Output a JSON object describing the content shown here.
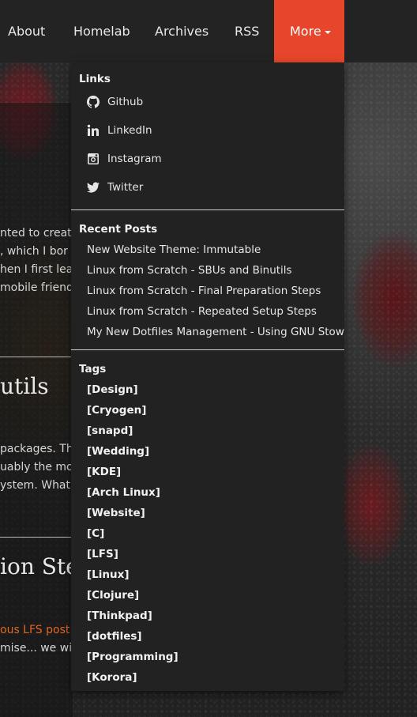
{
  "nav": {
    "items": [
      "About",
      "Homelab",
      "Archives",
      "RSS"
    ],
    "more_label": "More"
  },
  "background_article": {
    "lines_1": [
      "nted to creat",
      ", which I bor",
      "hen I first lear",
      "mobile friend"
    ],
    "title_2": "utils",
    "lines_2": [
      "packages. Th",
      "uably the mos",
      "ystem. What'"
    ],
    "title_3": "ion Ste",
    "link_3": "ous LFS post",
    "line_3b": "mise... we wi"
  },
  "dropdown": {
    "links_header": "Links",
    "links": [
      {
        "label": "Github",
        "icon": "github-icon"
      },
      {
        "label": "LinkedIn",
        "icon": "linkedin-icon"
      },
      {
        "label": "Instagram",
        "icon": "instagram-icon"
      },
      {
        "label": "Twitter",
        "icon": "twitter-icon"
      }
    ],
    "recent_header": "Recent Posts",
    "recent_posts": [
      "New Website Theme: Immutable",
      "Linux from Scratch - SBUs and Binutils",
      "Linux from Scratch - Final Preparation Steps",
      "Linux from Scratch - Repeated Setup Steps",
      "My New Dotfiles Management - Using GNU Stow"
    ],
    "tags_header": "Tags",
    "tags": [
      "[Design]",
      "[Cryogen]",
      "[snapd]",
      "[Wedding]",
      "[KDE]",
      "[Arch Linux]",
      "[Website]",
      "[C]",
      "[LFS]",
      "[Linux]",
      "[Clojure]",
      "[Thinkpad]",
      "[dotfiles]",
      "[Programming]",
      "[Korora]"
    ]
  },
  "colors": {
    "accent": "#e7462a",
    "navbar": "#232323",
    "dropdown_bg": "#222222",
    "link_orange": "#e0661f"
  }
}
